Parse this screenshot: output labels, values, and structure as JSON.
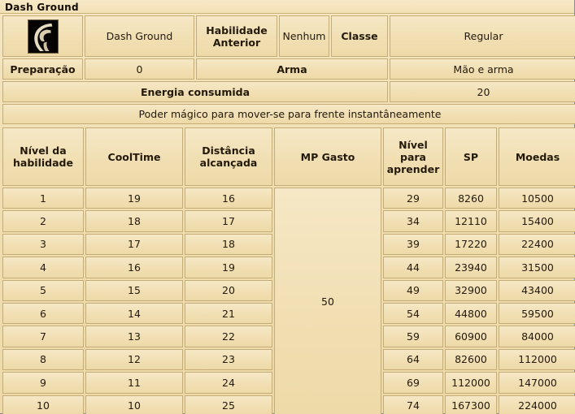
{
  "window": {
    "title": "Dash Ground"
  },
  "icon": {
    "name": "dash-ground-skill-icon"
  },
  "info": {
    "skill_name": "Dash Ground",
    "prev_skill_label": "Habilidade Anterior",
    "prev_skill_value": "Nenhum",
    "class_label": "Classe",
    "class_value": "Regular",
    "prep_label": "Preparação",
    "prep_value": "0",
    "weapon_label": "Arma",
    "weapon_value": "Mão e arma",
    "energy_label": "Energia consumida",
    "energy_value": "20",
    "description": "Poder mágico para mover-se para frente instantâneamente"
  },
  "table": {
    "headers": [
      "Nível da habilidade",
      "CoolTime",
      "Distância alcançada",
      "MP Gasto",
      "Nível para aprender",
      "SP",
      "Moedas"
    ],
    "mp_gasto": "50",
    "rows": [
      {
        "level": "1",
        "cooltime": "19",
        "distance": "16",
        "learn_level": "29",
        "sp": "8260",
        "coins": "10500"
      },
      {
        "level": "2",
        "cooltime": "18",
        "distance": "17",
        "learn_level": "34",
        "sp": "12110",
        "coins": "15400"
      },
      {
        "level": "3",
        "cooltime": "17",
        "distance": "18",
        "learn_level": "39",
        "sp": "17220",
        "coins": "22400"
      },
      {
        "level": "4",
        "cooltime": "16",
        "distance": "19",
        "learn_level": "44",
        "sp": "23940",
        "coins": "31500"
      },
      {
        "level": "5",
        "cooltime": "15",
        "distance": "20",
        "learn_level": "49",
        "sp": "32900",
        "coins": "43400"
      },
      {
        "level": "6",
        "cooltime": "14",
        "distance": "21",
        "learn_level": "54",
        "sp": "44800",
        "coins": "59500"
      },
      {
        "level": "7",
        "cooltime": "13",
        "distance": "22",
        "learn_level": "59",
        "sp": "60900",
        "coins": "84000"
      },
      {
        "level": "8",
        "cooltime": "12",
        "distance": "23",
        "learn_level": "64",
        "sp": "82600",
        "coins": "112000"
      },
      {
        "level": "9",
        "cooltime": "11",
        "distance": "24",
        "learn_level": "69",
        "sp": "112000",
        "coins": "147000"
      },
      {
        "level": "10",
        "cooltime": "10",
        "distance": "25",
        "learn_level": "74",
        "sp": "167300",
        "coins": "224000"
      }
    ]
  },
  "colors": {
    "background": "#f1dfb3",
    "border": "#c3ac78",
    "text": "#241a0b",
    "icon_background": "#000000",
    "icon_foreground": "#efe6cf"
  }
}
